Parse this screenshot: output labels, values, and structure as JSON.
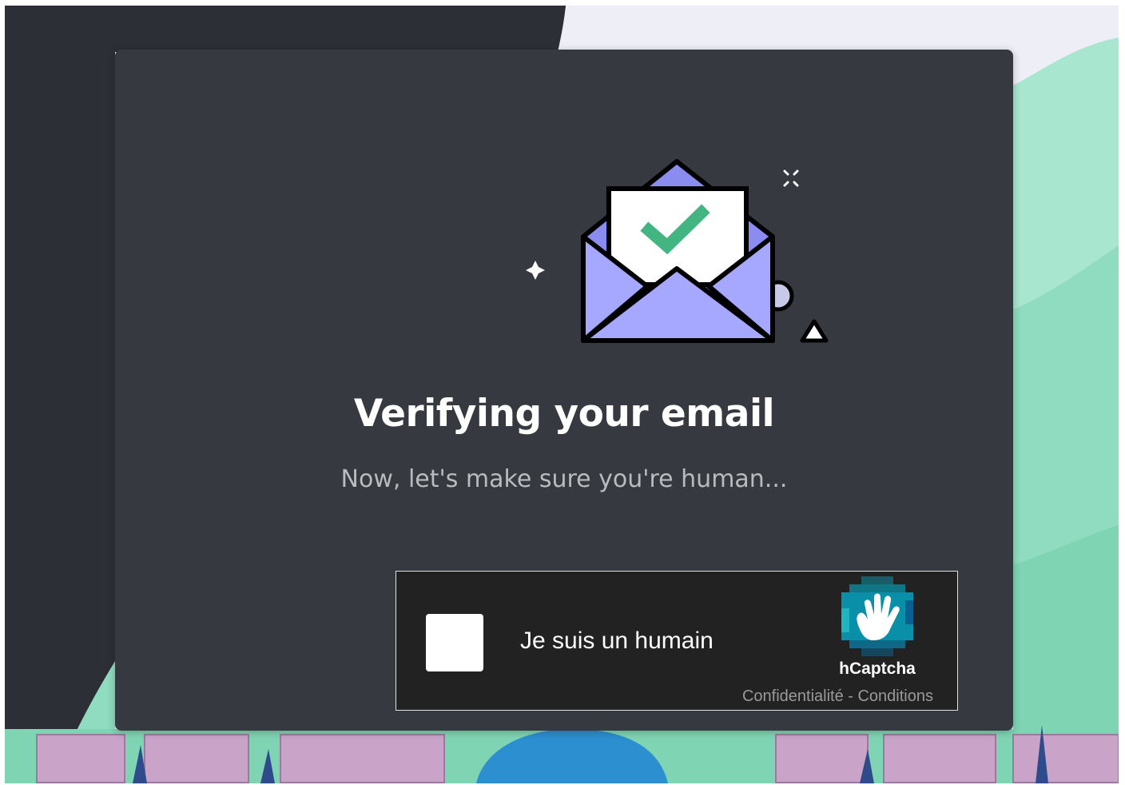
{
  "modal": {
    "title": "Verifying your email",
    "subtitle": "Now, let's make sure you're human..."
  },
  "captcha": {
    "checkbox_label": "Je suis un humain",
    "brand": "hCaptcha",
    "privacy_link": "Confidentialité",
    "separator": " - ",
    "terms_link": "Conditions"
  },
  "colors": {
    "modal_bg": "#36393f",
    "title": "#ffffff",
    "subtitle": "#b9bbbe",
    "captcha_bg": "#222222",
    "envelope": "#a6a8ff",
    "check": "#43b581",
    "hcaptcha_teal": "#0a8fa8"
  },
  "icons": [
    "envelope-check-icon",
    "sparkle-icon",
    "circle-icon",
    "triangle-icon",
    "hcaptcha-hand-icon"
  ]
}
